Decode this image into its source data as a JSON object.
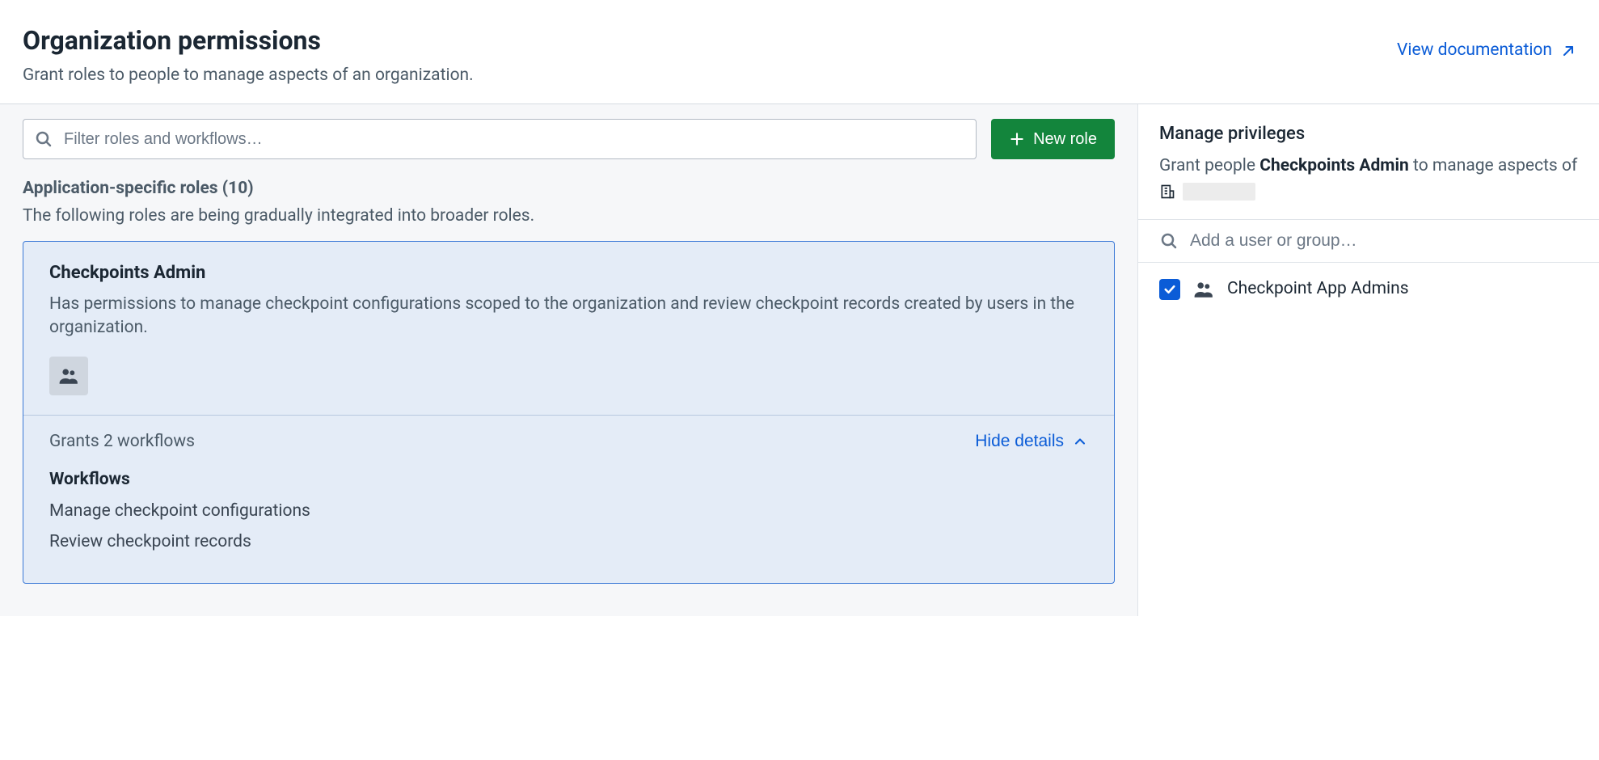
{
  "header": {
    "title": "Organization permissions",
    "subtitle": "Grant roles to people to manage aspects of an organization.",
    "doc_link": "View documentation"
  },
  "toolbar": {
    "filter_placeholder": "Filter roles and workflows…",
    "new_role_label": "New role"
  },
  "section": {
    "title": "Application-specific roles (10)",
    "subtitle": "The following roles are being gradually integrated into broader roles."
  },
  "role": {
    "name": "Checkpoints Admin",
    "description": "Has permissions to manage checkpoint configurations scoped to the organization and review checkpoint records created by users in the organization.",
    "grants_text": "Grants 2 workflows",
    "hide_details_label": "Hide details",
    "workflows_heading": "Workflows",
    "workflows": [
      "Manage checkpoint configurations",
      "Review checkpoint records"
    ]
  },
  "right": {
    "title": "Manage privileges",
    "sub_prefix": "Grant people ",
    "sub_role": "Checkpoints Admin",
    "sub_suffix": " to manage aspects of ",
    "search_placeholder": "Add a user or group…",
    "assignee": "Checkpoint App Admins"
  }
}
